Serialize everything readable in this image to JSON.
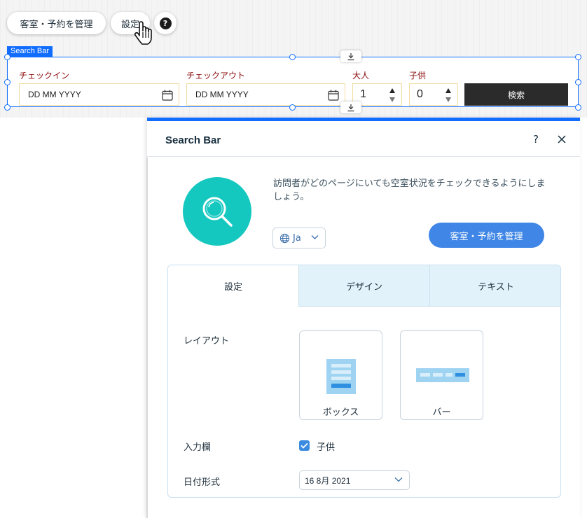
{
  "toolbar": {
    "manage_label": "客室・予約を管理",
    "settings_label": "設定",
    "help_label": "?"
  },
  "component": {
    "tag": "Search Bar"
  },
  "search_bar": {
    "checkin_label": "チェックイン",
    "checkout_label": "チェックアウト",
    "adults_label": "大人",
    "children_label": "子供",
    "checkin_value": "DD MM YYYY",
    "checkout_value": "DD MM YYYY",
    "adults_value": "1",
    "children_value": "0",
    "search_label": "検索",
    "label_color": "#8b0a0a",
    "button_color": "#2b2b2b"
  },
  "panel": {
    "title": "Search Bar",
    "help": "?",
    "description": "訪問者がどのページにいても空室状況をチェックできるようにしましょう。",
    "language": "Ja",
    "manage_button": "客室・予約を管理",
    "accent_color": "#116dff",
    "logo_color": "#14c8c0",
    "tabs": [
      {
        "label": "設定",
        "active": true
      },
      {
        "label": "デザイン",
        "active": false
      },
      {
        "label": "テキスト",
        "active": false
      }
    ],
    "layout_label": "レイアウト",
    "layout_options": [
      {
        "label": "ボックス",
        "icon": "box-layout-icon"
      },
      {
        "label": "バー",
        "icon": "bar-layout-icon"
      }
    ],
    "fields_label": "入力欄",
    "fields_checkbox": {
      "label": "子供",
      "checked": true
    },
    "date_format_label": "日付形式",
    "date_format_value": "16 8月 2021"
  }
}
